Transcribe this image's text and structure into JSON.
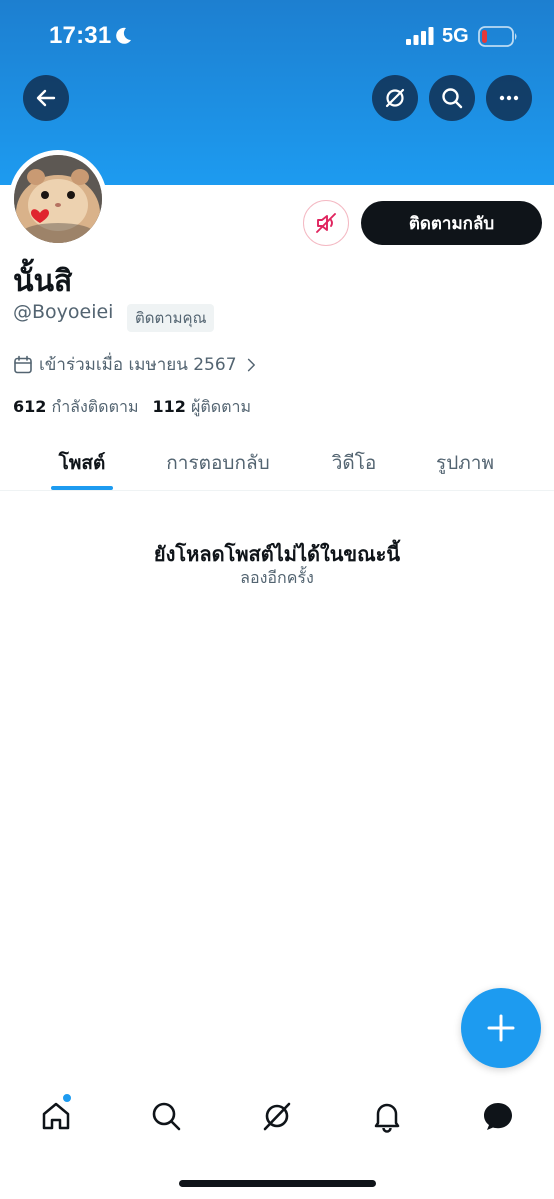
{
  "status_bar": {
    "time": "17:31",
    "network": "5G",
    "icons": [
      "moon-icon",
      "signal-icon",
      "battery-icon"
    ],
    "battery_color": "#e5383b"
  },
  "header": {
    "back_icon": "arrow-left-icon",
    "grok_icon": "grok-icon",
    "search_icon": "search-icon",
    "more_icon": "more-icon",
    "banner_color": "#1d9bf0"
  },
  "profile": {
    "display_name": "นั้นสิ",
    "handle": "@Boyoeiei",
    "follows_you": "ติดตามคุณ",
    "joined": "เข้าร่วมเมื่อ เมษายน 2567",
    "following_count": "612",
    "following_label": "กำลังติดตาม",
    "followers_count": "112",
    "followers_label": "ผู้ติดตาม"
  },
  "actions": {
    "mute_icon": "muted-speaker-icon",
    "follow_back_label": "ติดตามกลับ"
  },
  "tabs": [
    {
      "label": "โพสต์",
      "active": true
    },
    {
      "label": "การตอบกลับ",
      "active": false
    },
    {
      "label": "วิดีโอ",
      "active": false
    },
    {
      "label": "รูปภาพ",
      "active": false
    }
  ],
  "empty_state": {
    "title": "ยังโหลดโพสต์ไม่ได้ในขณะนี้",
    "subtitle": "ลองอีกครั้ง"
  },
  "fab": {
    "icon": "plus-icon",
    "color": "#1d9bf0"
  },
  "bottom_nav": {
    "items": [
      "home-icon",
      "search-icon",
      "grok-icon",
      "bell-icon",
      "messages-icon"
    ],
    "accent": "#1d9bf0"
  }
}
